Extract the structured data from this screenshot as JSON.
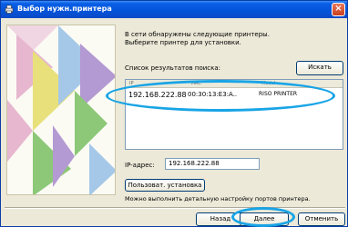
{
  "window": {
    "title": "Выбор нужн.принтера",
    "close_glyph": "×"
  },
  "message": {
    "line1": "В сети обнаружены следующие принтеры.",
    "line2": "Выберите принтер для установки."
  },
  "search": {
    "list_label": "Список результатов поиска:",
    "button_label": "Искать"
  },
  "printers": {
    "header": [
      "IP",
      "MAC",
      "Model"
    ],
    "rows": [
      {
        "ip": "192.168.222.88",
        "mac": "00:30:13:E3:A..",
        "model": "RISO PRINTER"
      }
    ]
  },
  "ip": {
    "label": "IP-адрес:",
    "value": "192.168.222.88"
  },
  "custom_install": {
    "button_label": "Пользоват. установка",
    "hint": "Можно выполнить детальную настройку портов принтера."
  },
  "footer": {
    "back_label": "Назад",
    "next_label": "Далее",
    "cancel_label": "Отменить"
  },
  "colors": {
    "title_bar": "#0453d8",
    "highlight": "#18a4e6",
    "art_pink": "#e7b6cf",
    "art_yellow": "#e8e07a",
    "art_green": "#8cc878",
    "art_purple": "#b49ad2",
    "art_blue": "#a6c8e8"
  },
  "icons": {
    "title": "printer-icon",
    "close": "close-icon"
  }
}
